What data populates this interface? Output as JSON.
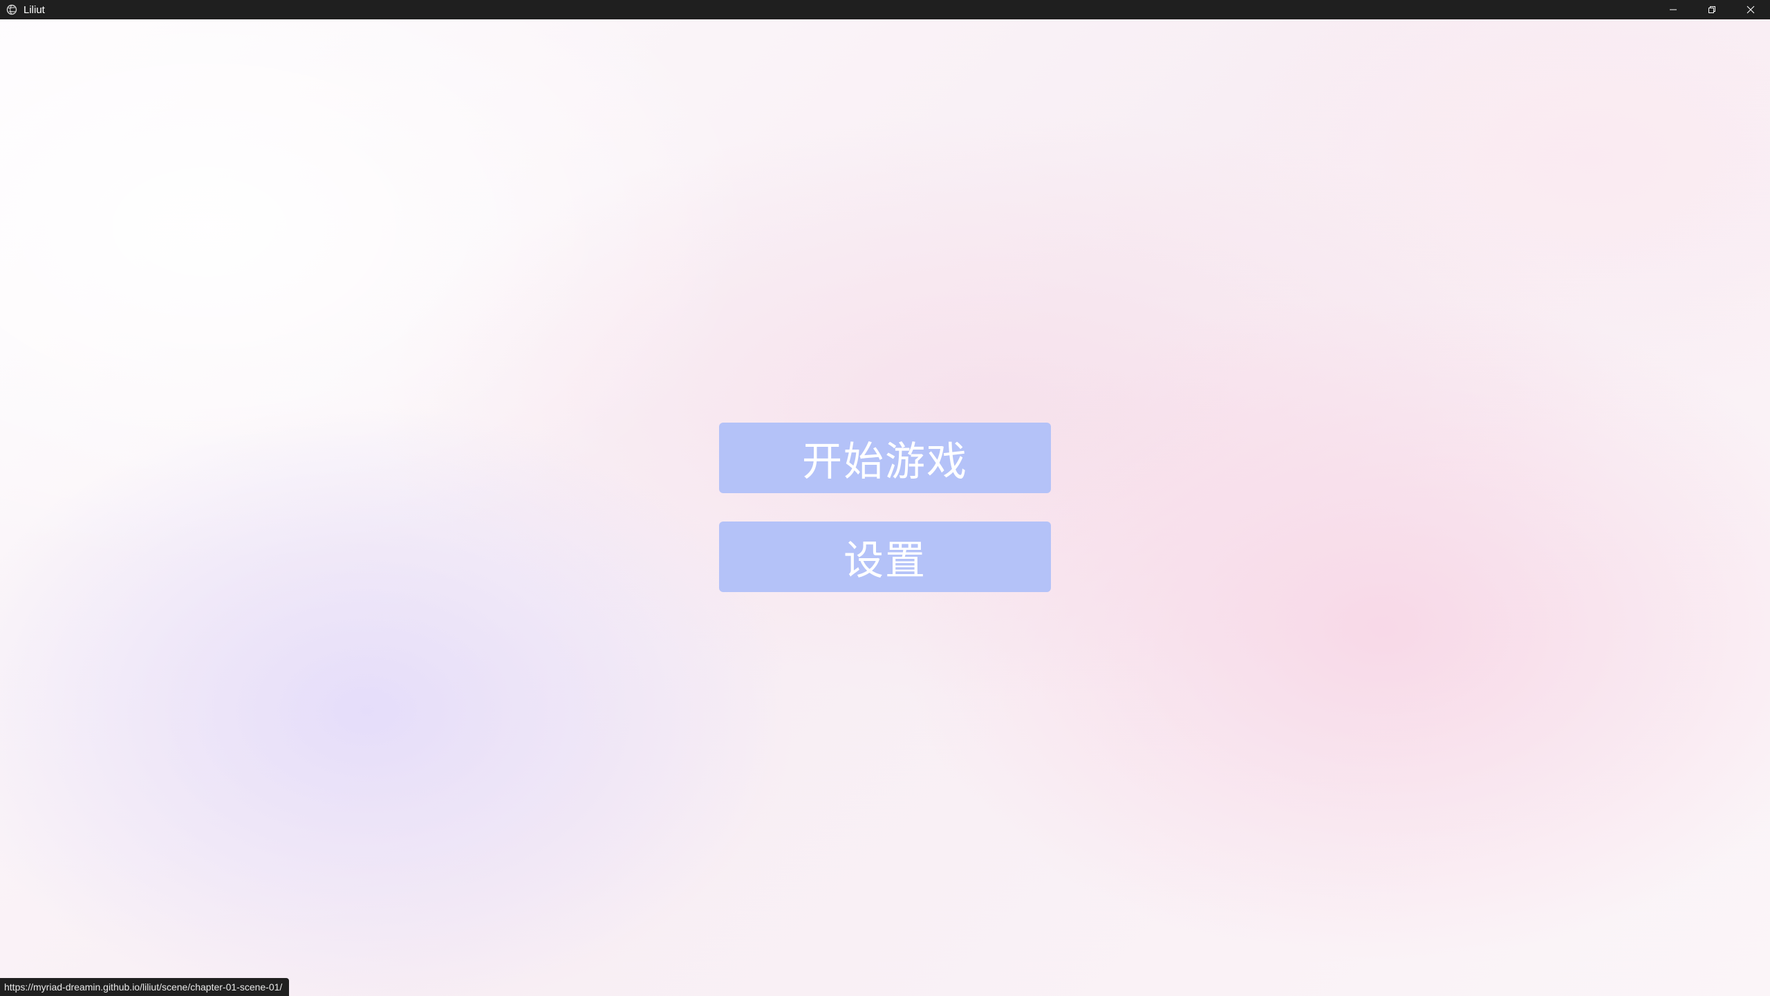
{
  "window": {
    "title": "Liliut",
    "app_icon": "globe-icon",
    "controls": {
      "minimize_icon": "minimize-icon",
      "restore_icon": "restore-icon",
      "close_icon": "close-icon"
    }
  },
  "main_menu": {
    "start_label": "开始游戏",
    "settings_label": "设置",
    "button_color": "#b4c2f8"
  },
  "status_bar": {
    "link_url": "https://myriad-dreamin.github.io/liliut/scene/chapter-01-scene-01/"
  },
  "colors": {
    "titlebar": "#1f1f1f",
    "background_pink": "#f8d6e6",
    "background_lavender": "#e4dcfa"
  }
}
